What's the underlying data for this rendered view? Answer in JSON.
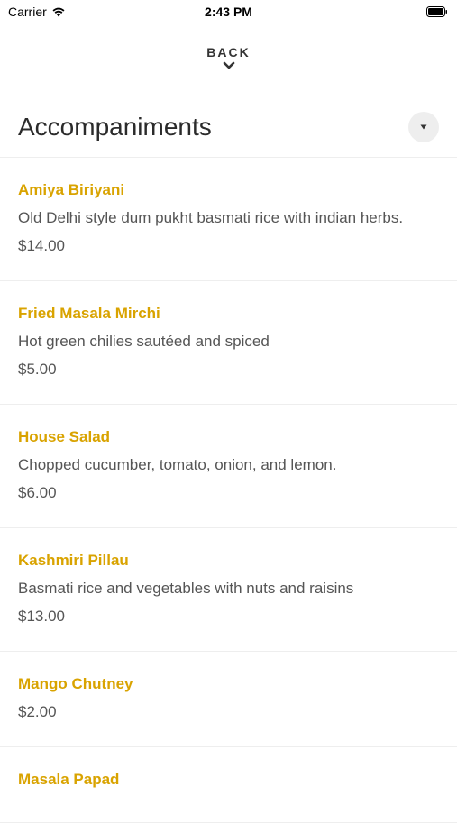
{
  "status_bar": {
    "carrier": "Carrier",
    "time": "2:43 PM"
  },
  "header": {
    "back_label": "BACK"
  },
  "section": {
    "title": "Accompaniments"
  },
  "items": [
    {
      "name": "Amiya Biriyani",
      "description": "Old Delhi style dum pukht basmati rice with indian herbs.",
      "price": "$14.00"
    },
    {
      "name": "Fried Masala Mirchi",
      "description": "Hot green chilies sautéed and spiced",
      "price": "$5.00"
    },
    {
      "name": "House Salad",
      "description": "Chopped cucumber, tomato, onion, and lemon.",
      "price": "$6.00"
    },
    {
      "name": "Kashmiri Pillau",
      "description": "Basmati rice and vegetables with nuts and raisins",
      "price": "$13.00"
    },
    {
      "name": "Mango Chutney",
      "price": "$2.00"
    },
    {
      "name": "Masala Papad"
    }
  ],
  "colors": {
    "accent": "#d9a300",
    "text": "#555555",
    "divider": "#eeeeee"
  }
}
